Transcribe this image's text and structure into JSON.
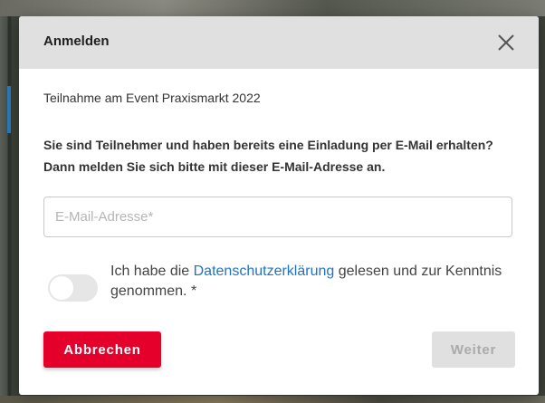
{
  "dialog": {
    "title": "Anmelden",
    "close_icon": "close-icon",
    "subtitle": "Teilnahme am Event Praxismarkt 2022",
    "instructions": "Sie sind Teilnehmer und haben bereits eine Einladung per E-Mail erhalten? Dann melden Sie sich bitte mit dieser E-Mail-Adresse an.",
    "email": {
      "placeholder": "E-Mail-Adresse*",
      "value": ""
    },
    "consent": {
      "checked": false,
      "text_before": "Ich habe die ",
      "link_text": "Datenschutzerklärung",
      "text_after": " gelesen und zur Kenntnis genommen. *"
    },
    "buttons": {
      "cancel_label": "Abbrechen",
      "next_label": "Weiter",
      "next_disabled": true
    }
  },
  "colors": {
    "primary": "#e4002b",
    "link": "#1f73c6",
    "header_bg": "#e0e0e0",
    "disabled_bg": "#e0e0e0"
  }
}
